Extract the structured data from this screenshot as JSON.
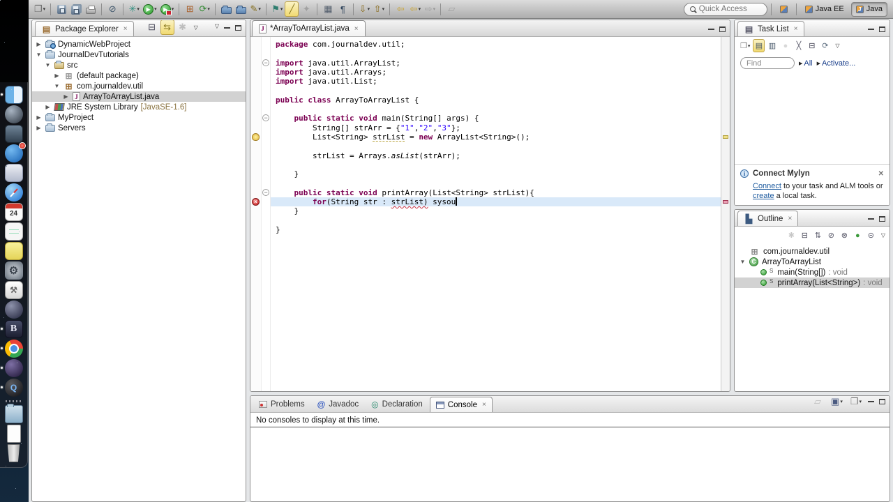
{
  "accent_colors": {
    "keyword": "#7B0052",
    "string": "#2A00FF",
    "current_line": "#d9e9f9",
    "selection": "#d2d2d2"
  },
  "dock": {
    "items": [
      {
        "name": "finder",
        "style": "finder",
        "running": true
      },
      {
        "name": "launchpad",
        "style": "launchpad"
      },
      {
        "name": "mission-control",
        "style": "mission"
      },
      {
        "name": "app-store",
        "style": "appstore",
        "badge": true
      },
      {
        "name": "preview",
        "style": "preview"
      },
      {
        "name": "safari",
        "style": "safari"
      },
      {
        "name": "calendar",
        "style": "calendar",
        "text": "24"
      },
      {
        "name": "reminders",
        "style": "reminders"
      },
      {
        "name": "stickies",
        "style": "stickies"
      },
      {
        "name": "system-preferences",
        "style": "sysprefs",
        "glyph": "⚙"
      },
      {
        "name": "utilities",
        "style": "toolbox",
        "glyph": "⚒"
      },
      {
        "name": "itunes",
        "style": "sphere1"
      },
      {
        "name": "bbedit",
        "style": "bbedit",
        "text": "B",
        "running": true
      },
      {
        "name": "chrome",
        "style": "chrome",
        "running": true
      },
      {
        "name": "eclipse",
        "style": "eclipse",
        "running": true
      },
      {
        "name": "quicktime",
        "style": "quicktime",
        "text": "Q",
        "running": true
      },
      {
        "name": "dock-separator",
        "style": "separator",
        "flat": true
      },
      {
        "name": "downloads-folder",
        "style": "folder"
      },
      {
        "name": "documents-stack",
        "style": "docs"
      },
      {
        "name": "trash",
        "style": "trash"
      }
    ]
  },
  "toolbar": {
    "groups": [
      [
        {
          "name": "new-wizard",
          "glyph": "❐",
          "color": "#6a6a6a",
          "dd": true
        }
      ],
      [
        {
          "name": "save",
          "kind": "floppy"
        },
        {
          "name": "save-all",
          "kind": "floppy2"
        },
        {
          "name": "print",
          "kind": "printer"
        }
      ],
      [
        {
          "name": "skip-all-breakpoints",
          "glyph": "⊘",
          "color": "#445a6e"
        }
      ],
      [
        {
          "name": "debug",
          "glyph": "✳",
          "color": "#2f8f7f",
          "dd": true
        },
        {
          "name": "run",
          "kind": "run",
          "dd": true
        },
        {
          "name": "run-external-tools",
          "kind": "runx",
          "dd": true
        }
      ],
      [
        {
          "name": "new-java-project",
          "glyph": "⊞",
          "color": "#a9612c"
        },
        {
          "name": "refresh",
          "glyph": "⟳",
          "color": "#348a34",
          "dd": true
        }
      ],
      [
        {
          "name": "open-type",
          "kind": "folder"
        },
        {
          "name": "open-resource",
          "kind": "folder"
        },
        {
          "name": "search",
          "glyph": "✎",
          "color": "#86701f",
          "dd": true
        }
      ],
      [
        {
          "name": "task-context",
          "glyph": "⚑",
          "color": "#2e7d6e",
          "dd": true
        },
        {
          "name": "mark-occurrences",
          "glyph": "╱",
          "color": "#8a7a22",
          "pressed": true
        },
        {
          "name": "new-task",
          "glyph": "✦",
          "disabled": true
        }
      ],
      [
        {
          "name": "show-selected-element",
          "glyph": "▦",
          "color": "#55606e"
        },
        {
          "name": "show-whitespace",
          "glyph": "¶",
          "color": "#31455c"
        }
      ],
      [
        {
          "name": "next-annotation",
          "glyph": "⇩",
          "color": "#8a6d1f",
          "dd": true
        },
        {
          "name": "previous-annotation",
          "glyph": "⇧",
          "color": "#8a6d1f",
          "dd": true
        }
      ],
      [
        {
          "name": "last-edit-location",
          "glyph": "⇦",
          "color": "#c9a227"
        },
        {
          "name": "back",
          "glyph": "⇦",
          "color": "#c9a227",
          "dd": true
        },
        {
          "name": "forward",
          "glyph": "⇨",
          "disabled": true,
          "dd": true
        }
      ],
      [
        {
          "name": "pin-editor",
          "glyph": "▱",
          "disabled": true
        }
      ]
    ],
    "quick_access_label": "Quick Access",
    "perspectives": {
      "items": [
        {
          "label": "Java EE",
          "active": false,
          "icon_text": ""
        },
        {
          "label": "Java",
          "active": true,
          "icon_text": "J"
        }
      ]
    }
  },
  "package_explorer": {
    "title": "Package Explorer",
    "toolbar": [
      {
        "name": "collapse-all",
        "glyph": "⊟",
        "color": "#445"
      },
      {
        "name": "link-with-editor",
        "glyph": "⇆",
        "color": "#8a7a22",
        "pressed": true
      },
      {
        "name": "focus-on-active-task",
        "glyph": "✱",
        "disabled": true
      }
    ],
    "tree": [
      {
        "d": 0,
        "a": "c",
        "ic": "web",
        "label": "DynamicWebProject"
      },
      {
        "d": 0,
        "a": "e",
        "ic": "proj",
        "label": "JournalDevTutorials"
      },
      {
        "d": 1,
        "a": "e",
        "ic": "src",
        "label": "src"
      },
      {
        "d": 2,
        "a": "c",
        "ic": "pkge",
        "label": "(default package)"
      },
      {
        "d": 2,
        "a": "e",
        "ic": "pkg",
        "label": "com.journaldev.util"
      },
      {
        "d": 3,
        "a": "c",
        "ic": "jfile",
        "label": "ArrayToArrayList.java",
        "sel": true
      },
      {
        "d": 1,
        "a": "c",
        "ic": "jre",
        "label": "JRE System Library ",
        "dec": "[JavaSE-1.6]"
      },
      {
        "d": 0,
        "a": "c",
        "ic": "proj",
        "label": "MyProject"
      },
      {
        "d": 0,
        "a": "c",
        "ic": "fold",
        "label": "Servers"
      }
    ]
  },
  "editor": {
    "tab": "*ArrayToArrayList.java",
    "current_line": 17,
    "folds": [
      2,
      8,
      16
    ],
    "warning_line": 10,
    "error_line": 17,
    "code": [
      [
        [
          "k",
          "package"
        ],
        [
          "p",
          " com.journaldev.util;"
        ]
      ],
      [],
      [
        [
          "k",
          "import"
        ],
        [
          "p",
          " java.util.ArrayList;"
        ]
      ],
      [
        [
          "k",
          "import"
        ],
        [
          "p",
          " java.util.Arrays;"
        ]
      ],
      [
        [
          "k",
          "import"
        ],
        [
          "p",
          " java.util.List;"
        ]
      ],
      [],
      [
        [
          "k",
          "public"
        ],
        [
          "p",
          " "
        ],
        [
          "k",
          "class"
        ],
        [
          "p",
          " ArrayToArrayList {"
        ]
      ],
      [],
      [
        [
          "p",
          "    "
        ],
        [
          "k",
          "public"
        ],
        [
          "p",
          " "
        ],
        [
          "k",
          "static"
        ],
        [
          "p",
          " "
        ],
        [
          "k",
          "void"
        ],
        [
          "p",
          " main(String[] args) {"
        ]
      ],
      [
        [
          "p",
          "        String[] strArr = {"
        ],
        [
          "s",
          "\"1\""
        ],
        [
          "p",
          ","
        ],
        [
          "s",
          "\"2\""
        ],
        [
          "p",
          ","
        ],
        [
          "s",
          "\"3\""
        ],
        [
          "p",
          "};"
        ]
      ],
      [
        [
          "p",
          "        List<String> "
        ],
        [
          "o",
          "strList"
        ],
        [
          "p",
          " = "
        ],
        [
          "k",
          "new"
        ],
        [
          "p",
          " ArrayList<String>();"
        ]
      ],
      [],
      [
        [
          "p",
          "        strList = Arrays."
        ],
        [
          "i",
          "asList"
        ],
        [
          "p",
          "(strArr);"
        ]
      ],
      [],
      [
        [
          "p",
          "    }"
        ]
      ],
      [],
      [
        [
          "p",
          "    "
        ],
        [
          "k",
          "public"
        ],
        [
          "p",
          " "
        ],
        [
          "k",
          "static"
        ],
        [
          "p",
          " "
        ],
        [
          "k",
          "void"
        ],
        [
          "p",
          " printArray(List<String> strList){"
        ]
      ],
      [
        [
          "p",
          "        "
        ],
        [
          "k",
          "for"
        ],
        [
          "p",
          "(String str : "
        ],
        [
          "e",
          "strList)"
        ],
        [
          "p",
          " sysou"
        ],
        [
          "c",
          ""
        ]
      ],
      [
        [
          "p",
          "    }"
        ]
      ],
      [],
      [
        [
          "p",
          "}"
        ]
      ]
    ]
  },
  "task_list": {
    "title": "Task List",
    "toolbar": [
      {
        "name": "new-task",
        "glyph": "❐",
        "color": "#777",
        "dd": true
      },
      {
        "name": "categorized-presentation",
        "glyph": "▤",
        "color": "#456",
        "pressed": true
      },
      {
        "name": "scheduled-presentation",
        "glyph": "▥",
        "color": "#456"
      },
      {
        "name": "task-presentation",
        "glyph": "●",
        "color": "#888",
        "disabled": true
      },
      {
        "name": "deactivate-task",
        "glyph": "╳",
        "color": "#556"
      },
      {
        "name": "collapse-all",
        "glyph": "⊟",
        "color": "#445"
      },
      {
        "name": "synchronize",
        "glyph": "⟳",
        "color": "#5a6b7d"
      }
    ],
    "find_placeholder": "Find",
    "filter_all_label": "All",
    "activate_label": "Activate...",
    "mylyn": {
      "title": "Connect Mylyn",
      "body_parts": [
        {
          "t": "Connect",
          "link": true
        },
        {
          "t": " to your task and ALM tools or "
        },
        {
          "t": "create",
          "link": true
        },
        {
          "t": " a local task."
        }
      ]
    }
  },
  "outline": {
    "title": "Outline",
    "toolbar": [
      {
        "name": "focus-on-active-task",
        "glyph": "✱",
        "disabled": true
      },
      {
        "name": "collapse-all",
        "glyph": "⊟",
        "color": "#445"
      },
      {
        "name": "sort",
        "glyph": "⇅",
        "color": "#556"
      },
      {
        "name": "hide-fields",
        "glyph": "⊘",
        "color": "#556"
      },
      {
        "name": "hide-static-members",
        "glyph": "⊗",
        "color": "#556"
      },
      {
        "name": "hide-non-public-members",
        "glyph": "●",
        "color": "#3b9a3b"
      },
      {
        "name": "hide-local-types",
        "glyph": "⊝",
        "color": "#556"
      }
    ],
    "tree": [
      {
        "d": 0,
        "a": "n",
        "ic": "pkg",
        "label": "com.journaldev.util"
      },
      {
        "d": 0,
        "a": "e",
        "ic": "class",
        "label": "ArrayToArrayList"
      },
      {
        "d": 1,
        "a": "n",
        "ic": "method",
        "static": "S",
        "label": "main(String[])",
        "type": " : void"
      },
      {
        "d": 1,
        "a": "n",
        "ic": "method",
        "static": "S",
        "label": "printArray(List<String>)",
        "type": " : void",
        "sel": true
      }
    ]
  },
  "console": {
    "tabs": [
      {
        "label": "Problems",
        "icon": "problems",
        "selected": false
      },
      {
        "label": "Javadoc",
        "icon": "javadoc",
        "selected": false
      },
      {
        "label": "Declaration",
        "icon": "declaration",
        "selected": false
      },
      {
        "label": "Console",
        "icon": "console",
        "selected": true
      }
    ],
    "message": "No consoles to display at this time.",
    "toolbar": [
      {
        "name": "pin-console",
        "glyph": "▱",
        "disabled": true
      },
      {
        "name": "display-selected-console",
        "glyph": "▣",
        "color": "#4a5a80",
        "dd": true
      },
      {
        "name": "open-console",
        "glyph": "❐",
        "color": "#777",
        "dd": true
      }
    ]
  }
}
